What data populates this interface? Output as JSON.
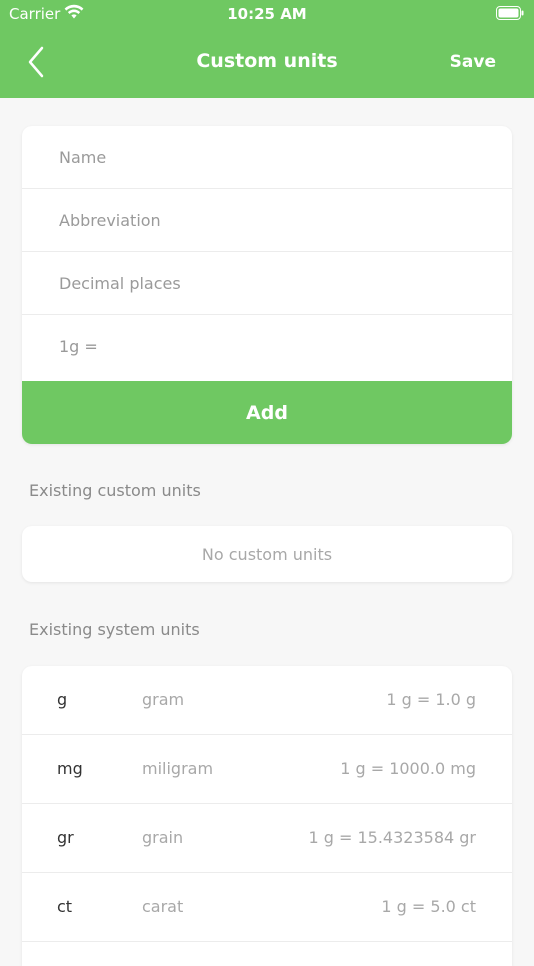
{
  "status_bar": {
    "carrier": "Carrier",
    "time": "10:25 AM"
  },
  "nav": {
    "title": "Custom units",
    "save_label": "Save",
    "back_icon": "chevron-left-icon"
  },
  "form": {
    "name_placeholder": "Name",
    "abbreviation_placeholder": "Abbreviation",
    "decimal_places_placeholder": "Decimal places",
    "conversion_placeholder": "1g =",
    "add_label": "Add"
  },
  "custom_units": {
    "title": "Existing custom units",
    "empty_text": "No custom units"
  },
  "system_units": {
    "title": "Existing system units",
    "items": [
      {
        "abbr": "g",
        "name": "gram",
        "conversion": "1 g = 1.0 g"
      },
      {
        "abbr": "mg",
        "name": "miligram",
        "conversion": "1 g = 1000.0 mg"
      },
      {
        "abbr": "gr",
        "name": "grain",
        "conversion": "1 g = 15.4323584 gr"
      },
      {
        "abbr": "ct",
        "name": "carat",
        "conversion": "1 g = 5.0 ct"
      }
    ]
  },
  "colors": {
    "accent": "#6fc862",
    "background": "#f7f7f7"
  }
}
